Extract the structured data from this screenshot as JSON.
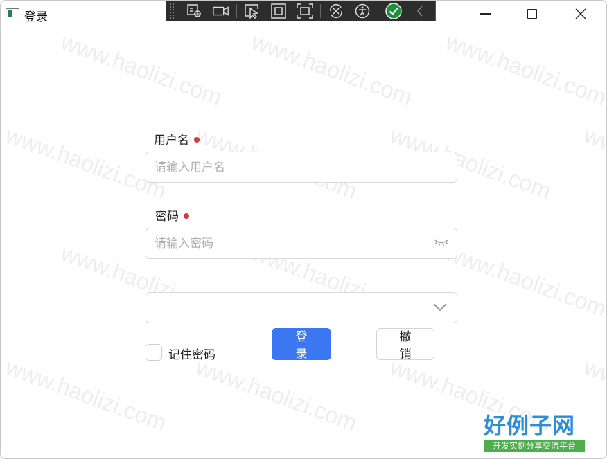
{
  "window": {
    "title": "登录",
    "icon": "app-window-icon",
    "controls": [
      "minimize-icon",
      "maximize-icon",
      "close-icon"
    ]
  },
  "debug_toolbar": {
    "icons": [
      "select-element-icon",
      "video-camera-icon",
      "pointer-select-icon",
      "square-frame-icon",
      "snapshot-frame-icon",
      "hot-reload-icon",
      "accessibility-icon",
      "check-circle-icon",
      "chevron-left-icon"
    ]
  },
  "watermark": "www.haolizi.com",
  "form": {
    "username": {
      "label": "用户名",
      "placeholder": "请输入用户名",
      "required": true
    },
    "password": {
      "label": "密码",
      "placeholder": "请输入密码",
      "required": true,
      "toggle_icon": "eye-closed-icon"
    },
    "select": {
      "value": "",
      "icon": "chevron-down-icon"
    },
    "remember": {
      "label": "记住密码",
      "checked": false
    },
    "login_button": "登 录",
    "cancel_button": "撤 销"
  },
  "logo": {
    "main": "好例子网",
    "sub": "开发实例分享交流平台"
  },
  "colors": {
    "primary": "#3b77f0",
    "required_dot": "#d9363e",
    "logo_blue": "#2a8fd8",
    "logo_green": "#4cae4c"
  }
}
